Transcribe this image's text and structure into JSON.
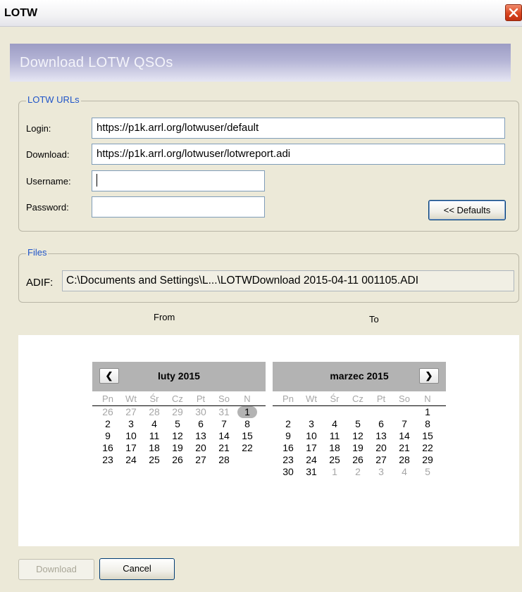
{
  "window": {
    "title": "LOTW"
  },
  "header": {
    "title": "Download LOTW QSOs"
  },
  "urls": {
    "legend": "LOTW URLs",
    "login_label": "Login:",
    "login_value": "https://p1k.arrl.org/lotwuser/default",
    "download_label": "Download:",
    "download_value": "https://p1k.arrl.org/lotwuser/lotwreport.adi",
    "username_label": "Username:",
    "username_value": "",
    "password_label": "Password:",
    "password_value": "",
    "defaults_button": "<< Defaults"
  },
  "files": {
    "legend": "Files",
    "adif_label": "ADIF:",
    "adif_value": "C:\\Documents and Settings\\L...\\LOTWDownload 2015-04-11 001105.ADI"
  },
  "range": {
    "from_label": "From",
    "to_label": "To"
  },
  "calendar": {
    "weekdays": [
      "Pn",
      "Wt",
      "Śr",
      "Cz",
      "Pt",
      "So",
      "N"
    ],
    "months": [
      {
        "title": "luty 2015",
        "nav": "prev",
        "selected_day": 1,
        "weeks": [
          [
            {
              "d": "26",
              "o": true
            },
            {
              "d": "27",
              "o": true
            },
            {
              "d": "28",
              "o": true
            },
            {
              "d": "29",
              "o": true
            },
            {
              "d": "30",
              "o": true
            },
            {
              "d": "31",
              "o": true
            },
            {
              "d": "1",
              "o": false,
              "sel": true
            }
          ],
          [
            {
              "d": "2"
            },
            {
              "d": "3"
            },
            {
              "d": "4"
            },
            {
              "d": "5"
            },
            {
              "d": "6"
            },
            {
              "d": "7"
            },
            {
              "d": "8"
            }
          ],
          [
            {
              "d": "9"
            },
            {
              "d": "10"
            },
            {
              "d": "11"
            },
            {
              "d": "12"
            },
            {
              "d": "13"
            },
            {
              "d": "14"
            },
            {
              "d": "15"
            }
          ],
          [
            {
              "d": "16"
            },
            {
              "d": "17"
            },
            {
              "d": "18"
            },
            {
              "d": "19"
            },
            {
              "d": "20"
            },
            {
              "d": "21"
            },
            {
              "d": "22"
            }
          ],
          [
            {
              "d": "23"
            },
            {
              "d": "24"
            },
            {
              "d": "25"
            },
            {
              "d": "26"
            },
            {
              "d": "27"
            },
            {
              "d": "28"
            },
            {
              "d": ""
            }
          ]
        ]
      },
      {
        "title": "marzec 2015",
        "nav": "next",
        "weeks": [
          [
            {
              "d": ""
            },
            {
              "d": ""
            },
            {
              "d": ""
            },
            {
              "d": ""
            },
            {
              "d": ""
            },
            {
              "d": ""
            },
            {
              "d": "1"
            }
          ],
          [
            {
              "d": "2"
            },
            {
              "d": "3"
            },
            {
              "d": "4"
            },
            {
              "d": "5"
            },
            {
              "d": "6"
            },
            {
              "d": "7"
            },
            {
              "d": "8"
            }
          ],
          [
            {
              "d": "9"
            },
            {
              "d": "10"
            },
            {
              "d": "11"
            },
            {
              "d": "12"
            },
            {
              "d": "13"
            },
            {
              "d": "14"
            },
            {
              "d": "15"
            }
          ],
          [
            {
              "d": "16"
            },
            {
              "d": "17"
            },
            {
              "d": "18"
            },
            {
              "d": "19"
            },
            {
              "d": "20"
            },
            {
              "d": "21"
            },
            {
              "d": "22"
            }
          ],
          [
            {
              "d": "23"
            },
            {
              "d": "24"
            },
            {
              "d": "25"
            },
            {
              "d": "26"
            },
            {
              "d": "27"
            },
            {
              "d": "28"
            },
            {
              "d": "29"
            }
          ],
          [
            {
              "d": "30"
            },
            {
              "d": "31"
            },
            {
              "d": "1",
              "o": true
            },
            {
              "d": "2",
              "o": true
            },
            {
              "d": "3",
              "o": true
            },
            {
              "d": "4",
              "o": true
            },
            {
              "d": "5",
              "o": true
            }
          ]
        ]
      }
    ]
  },
  "footer": {
    "download_button": "Download",
    "cancel_button": "Cancel"
  },
  "colors": {
    "accent": "#1f54c8",
    "close": "#d9441f",
    "header": "#b5b5d6"
  }
}
